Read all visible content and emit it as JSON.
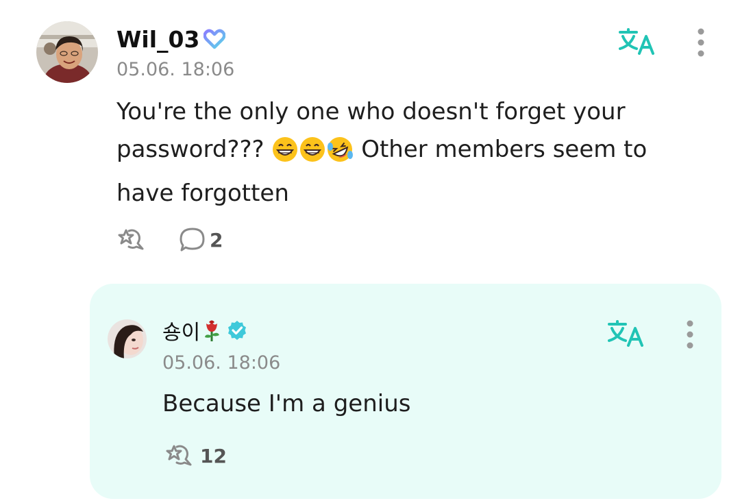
{
  "comment": {
    "username": "Wil_03",
    "badge_icon": "heart-badge-icon",
    "timestamp": "05.06. 18:06",
    "text_part1": "You're the only one who doesn't forget your password???",
    "emojis": [
      "grinning-face-emoji",
      "grinning-face-emoji",
      "rolling-laughing-emoji"
    ],
    "text_part2": "Other members seem to have forgotten",
    "translate_icon": "translate-icon",
    "more_icon": "more-vertical-icon",
    "like_icon": "like-icon",
    "reply_icon": "speech-bubble-icon",
    "reply_count": "2"
  },
  "reply": {
    "username": "숑이",
    "username_emoji": "rose-emoji",
    "verified_icon": "verified-badge-icon",
    "timestamp": "05.06. 18:06",
    "text": "Because I'm a genius",
    "translate_icon": "translate-icon",
    "more_icon": "more-vertical-icon",
    "like_icon": "like-icon",
    "like_count": "12"
  },
  "colors": {
    "accent": "#21c4b5",
    "reply_background": "#e8fcf8",
    "timestamp": "#8a8a8a",
    "badge_gradient_start": "#8a7dff",
    "badge_gradient_end": "#5bd6e8",
    "verified": "#3ec9da"
  }
}
